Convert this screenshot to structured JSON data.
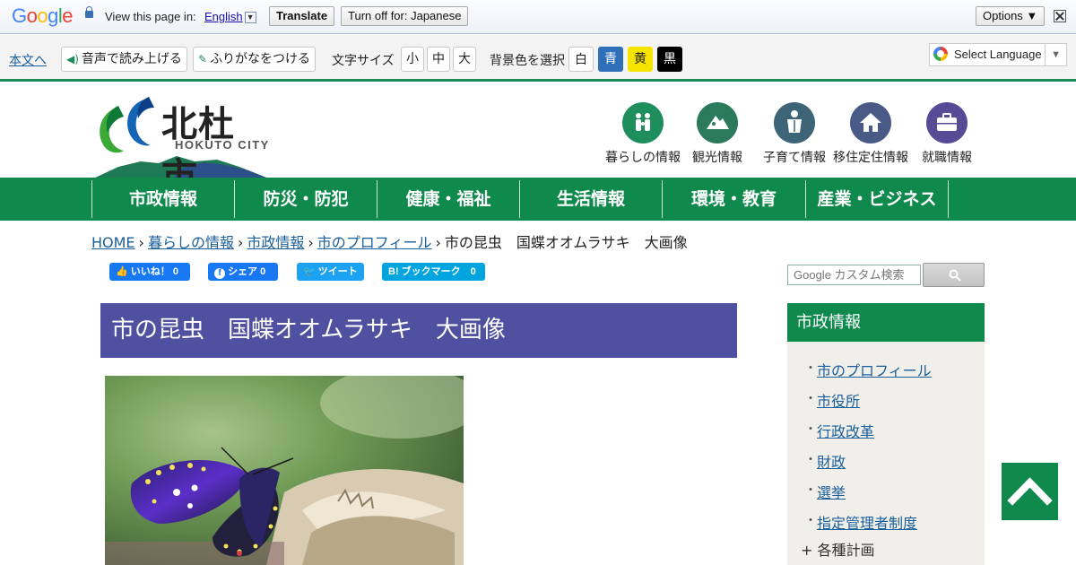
{
  "translate_bar": {
    "logo": "Google",
    "view_text": "View this page in:",
    "language": "English",
    "language_arrow": "▼",
    "translate_label": "Translate",
    "turn_off_label": "Turn off for: Japanese",
    "options_label": "Options ▼"
  },
  "accessibility": {
    "skip_link": "本文へ",
    "read_aloud": "音声で読み上げる",
    "furigana": "ふりがなをつける",
    "font_size_label": "文字サイズ",
    "font_sizes": [
      "小",
      "中",
      "大"
    ],
    "bg_color_label": "背景色を選択",
    "bg_colors": [
      {
        "label": "白",
        "bg": "#ffffff",
        "fg": "#222222"
      },
      {
        "label": "青",
        "bg": "#2f6fb8",
        "fg": "#ffffff"
      },
      {
        "label": "黄",
        "bg": "#f5e400",
        "fg": "#222222"
      },
      {
        "label": "黒",
        "bg": "#000000",
        "fg": "#ffffff"
      }
    ],
    "select_language": "Select Language",
    "select_arrow": "▼"
  },
  "header": {
    "logo_title": "北杜市",
    "logo_sub": "HOKUTO CITY",
    "quick_nav": [
      {
        "label": "暮らしの情報",
        "color": "#1e8f5c",
        "icon": "family-icon"
      },
      {
        "label": "観光情報",
        "color": "#2c7a5c",
        "icon": "mountain-icon"
      },
      {
        "label": "子育て情報",
        "color": "#3e6478",
        "icon": "child-icon"
      },
      {
        "label": "移住定住情報",
        "color": "#4a5a86",
        "icon": "house-icon"
      },
      {
        "label": "就職情報",
        "color": "#574b96",
        "icon": "briefcase-icon"
      }
    ]
  },
  "main_nav": [
    "市政情報",
    "防災・防犯",
    "健康・福祉",
    "生活情報",
    "環境・教育",
    "産業・ビジネス"
  ],
  "breadcrumb": {
    "links": [
      "HOME",
      "暮らしの情報",
      "市政情報",
      "市のプロフィール"
    ],
    "current": "市の昆虫　国蝶オオムラサキ　大画像",
    "separator": "›"
  },
  "social": {
    "like": "いいね！ 0",
    "share": "シェア 0",
    "tweet": "ツイート",
    "bookmark": "B! ブックマーク　0"
  },
  "search": {
    "placeholder": "Google カスタム検索"
  },
  "page_title": "市の昆虫　国蝶オオムラサキ　大画像",
  "sidebar": {
    "heading": "市政情報",
    "links": [
      "市のプロフィール",
      "市役所",
      "行政改革",
      "財政",
      "選挙",
      "指定管理者制度"
    ],
    "expandable": "+ 各種計画"
  }
}
